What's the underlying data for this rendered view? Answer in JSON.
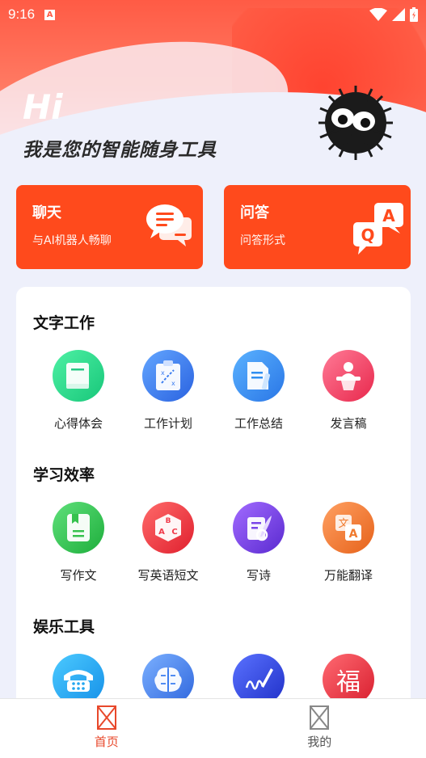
{
  "status": {
    "time": "9:16",
    "sim_icon": "A"
  },
  "header": {
    "greeting": "Hi",
    "slogan": "我是您的智能随身工具"
  },
  "cards": [
    {
      "title": "聊天",
      "subtitle": "与AI机器人畅聊",
      "icon": "chat-bubbles-icon"
    },
    {
      "title": "问答",
      "subtitle": "问答形式",
      "icon": "qa-bubbles-icon"
    }
  ],
  "sections": [
    {
      "title": "文字工作",
      "items": [
        {
          "label": "心得体会",
          "icon": "book-icon",
          "color": "#2fd28a"
        },
        {
          "label": "工作计划",
          "icon": "clipboard-plan-icon",
          "color": "#3a7cf0"
        },
        {
          "label": "工作总结",
          "icon": "document-pen-icon",
          "color": "#2f8ef0"
        },
        {
          "label": "发言稿",
          "icon": "podium-speaker-icon",
          "color": "#f0466a"
        }
      ]
    },
    {
      "title": "学习效率",
      "items": [
        {
          "label": "写作文",
          "icon": "notebook-icon",
          "color": "#37c24e"
        },
        {
          "label": "写英语短文",
          "icon": "abc-cube-icon",
          "color": "#f03a4a"
        },
        {
          "label": "写诗",
          "icon": "quill-scroll-icon",
          "color": "#7a45e8"
        },
        {
          "label": "万能翻译",
          "icon": "translate-icon",
          "color": "#f07a2e"
        }
      ]
    },
    {
      "title": "娱乐工具",
      "items": [
        {
          "label": "",
          "icon": "telephone-icon",
          "color": "#22a6f0"
        },
        {
          "label": "",
          "icon": "brain-icon",
          "color": "#3a7cf0"
        },
        {
          "label": "",
          "icon": "signature-pen-icon",
          "color": "#3848e0"
        },
        {
          "label": "",
          "icon": "fu-character-icon",
          "color": "#ef3a48",
          "glyph": "福"
        }
      ]
    }
  ],
  "nav": [
    {
      "label": "首页",
      "active": true
    },
    {
      "label": "我的",
      "active": false
    }
  ],
  "colors": {
    "accent": "#ff4a1c",
    "nav_active": "#e8482b"
  }
}
